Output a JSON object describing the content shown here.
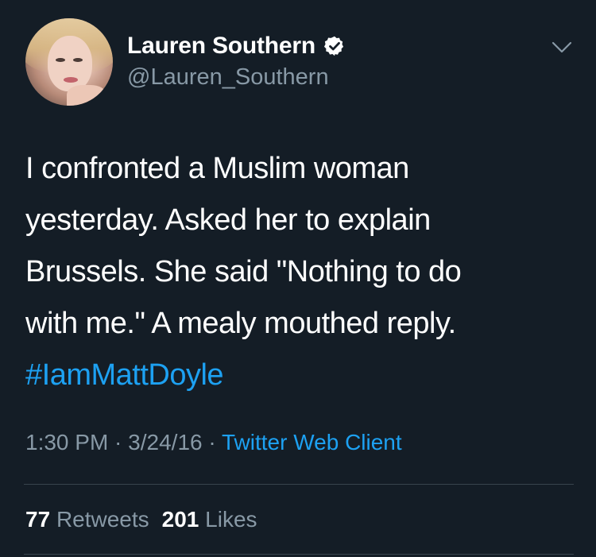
{
  "user": {
    "display_name": "Lauren Southern",
    "handle": "@Lauren_Southern",
    "verified": true
  },
  "tweet": {
    "lines": [
      "I confronted a Muslim woman",
      "yesterday. Asked her to explain",
      "Brussels. She said \"Nothing to do",
      "with me.\" A mealy mouthed reply."
    ],
    "hashtag": "#IamMattDoyle"
  },
  "meta": {
    "time": "1:30 PM",
    "separator_1": " · ",
    "date": "3/24/16",
    "separator_2": " · ",
    "source": "Twitter Web Client"
  },
  "stats": {
    "retweets_count": "77",
    "retweets_label": "Retweets",
    "likes_count": "201",
    "likes_label": "Likes"
  },
  "icons": {
    "verified": "verified-badge-icon",
    "menu": "chevron-down-icon"
  },
  "colors": {
    "background": "#141d26",
    "text": "#ffffff",
    "secondary": "#8899a6",
    "accent": "#1da1f2",
    "divider": "#38444d"
  }
}
